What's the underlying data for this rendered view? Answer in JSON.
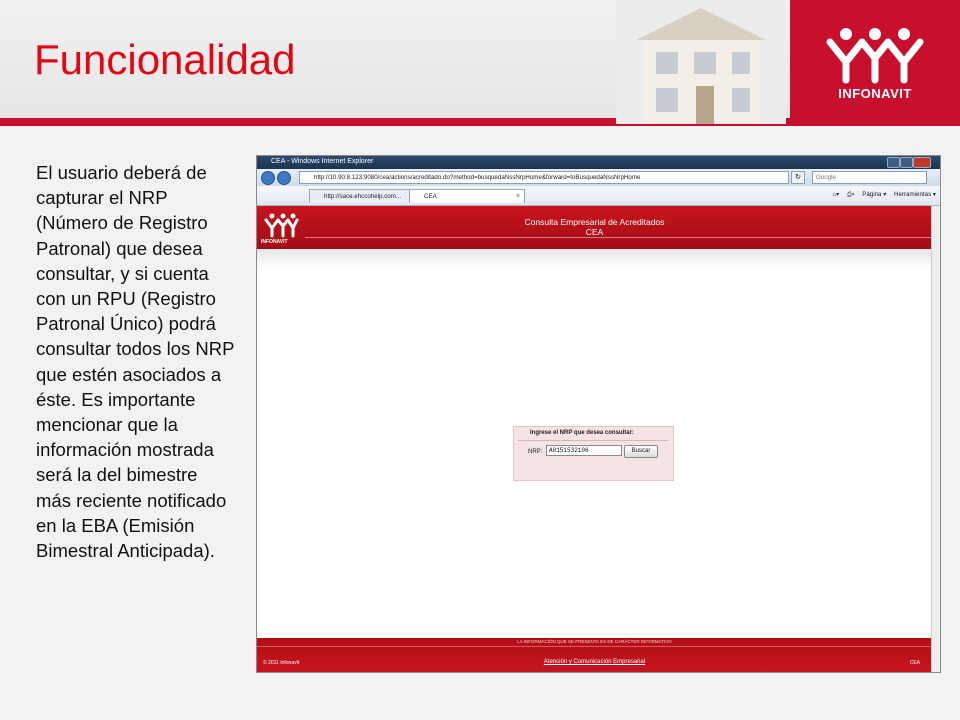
{
  "slide": {
    "title": "Funcionalidad",
    "logo_text": "INFONAVIT",
    "body": "El usuario deberá de capturar el NRP (Número de Registro Patronal) que desea consultar, y si cuenta con un RPU (Registro Patronal Único) podrá consultar todos los NRP que estén asociados a éste. Es importante mencionar que la información mostrada será la del bimestre más reciente notificado en la EBA (Emisión Bimestral Anticipada)."
  },
  "browser": {
    "window_title": "CEA - Windows Internet Explorer",
    "url": "http://10.90.8.123:9080/cea/actions/acreditado.do?method=busquedaNssNrpHome&forward=toBusquedaNssNrpHome",
    "search_placeholder": "Google",
    "tabs": [
      {
        "label": "http://sace.ehccohelp.com..."
      },
      {
        "label": "CEA",
        "close": "×"
      }
    ],
    "commands": {
      "pagina": "Página ▾",
      "herramientas": "Herramientas ▾"
    }
  },
  "app": {
    "logo_text": "INFONAVIT",
    "title_line1": "Consulta Empresarial de Acreditados",
    "title_line2": "CEA",
    "form": {
      "prompt": "Ingrese el NRP que desea consultar:",
      "nrp_label": "NRP:",
      "nrp_value": "A0151532106",
      "search_button": "Buscar"
    },
    "footer": {
      "note": "LA INFORMACIÓN QUE SE PRESENTA ES DE CARÁCTER INFORMATIVO",
      "copyright": "© 2011 Infonavit",
      "link": "Atención y Comunicación Empresarial",
      "right": "CEA"
    }
  },
  "colors": {
    "brand_red": "#c8102e",
    "title_red": "#e30613"
  }
}
